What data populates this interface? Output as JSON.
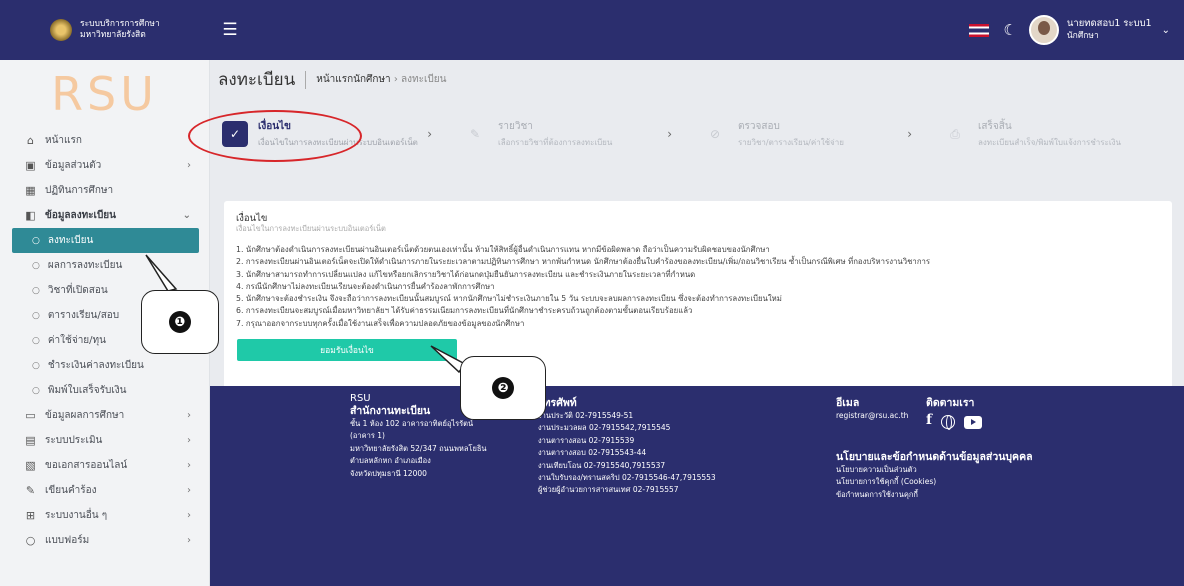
{
  "header": {
    "brand_line1": "ระบบบริการการศึกษา",
    "brand_line2": "มหาวิทยาลัยรังสิต",
    "user_name": "นายทดสอบ1 ระบบ1",
    "user_role": "นักศึกษา"
  },
  "sidebar": {
    "logo": "RSU",
    "items": [
      {
        "label": "หน้าแรก",
        "icon": "home-icon"
      },
      {
        "label": "ข้อมูลส่วนตัว",
        "icon": "id-card-icon"
      },
      {
        "label": "ปฏิทินการศึกษา",
        "icon": "calendar-icon"
      },
      {
        "label": "ข้อมูลลงทะเบียน",
        "icon": "register-icon"
      },
      {
        "label": "ลงทะเบียน"
      },
      {
        "label": "ผลการลงทะเบียน"
      },
      {
        "label": "วิชาที่เปิดสอน"
      },
      {
        "label": "ตารางเรียน/สอบ"
      },
      {
        "label": "ค่าใช้จ่าย/ทุน"
      },
      {
        "label": "ชำระเงินค่าลงทะเบียน"
      },
      {
        "label": "พิมพ์ใบเสร็จรับเงิน"
      },
      {
        "label": "ข้อมูลผลการศึกษา",
        "icon": "monitor-icon"
      },
      {
        "label": "ระบบประเมิน",
        "icon": "clipboard-icon"
      },
      {
        "label": "ขอเอกสารออนไลน์",
        "icon": "document-icon"
      },
      {
        "label": "เขียนคำร้อง",
        "icon": "edit-icon"
      },
      {
        "label": "ระบบงานอื่น ๆ",
        "icon": "grid-icon"
      },
      {
        "label": "แบบฟอร์ม",
        "icon": "circle-icon"
      }
    ]
  },
  "page": {
    "title": "ลงทะเบียน",
    "breadcrumb_home": "หน้าแรกนักศึกษา",
    "breadcrumb_sep": "›",
    "breadcrumb_current": "ลงทะเบียน"
  },
  "steps": [
    {
      "name": "เงื่อนไข",
      "desc": "เงื่อนไขในการลงทะเบียนผ่านระบบอินเตอร์เน็ต"
    },
    {
      "name": "รายวิชา",
      "desc": "เลือกรายวิชาที่ต้องการลงทะเบียน"
    },
    {
      "name": "ตรวจสอบ",
      "desc": "รายวิชา/ตารางเรียน/ค่าใช้จ่าย"
    },
    {
      "name": "เสร็จสิ้น",
      "desc": "ลงทะเบียนสำเร็จ/พิมพ์ใบแจ้งการชำระเงิน"
    }
  ],
  "card": {
    "heading": "เงื่อนไข",
    "subheading": "เงื่อนไขในการลงทะเบียนผ่านระบบอินเตอร์เน็ต",
    "rules": [
      "1. นักศึกษาต้องดำเนินการลงทะเบียนผ่านอินเตอร์เน็ตด้วยตนเองเท่านั้น ห้ามให้สิทธิ์ผู้อื่นดำเนินการแทน หากมีข้อผิดพลาด ถือว่าเป็นความรับผิดชอบของนักศึกษา",
      "2. การลงทะเบียนผ่านอินเตอร์เน็ตจะเปิดให้ดำเนินการภายในระยะเวลาตามปฏิทินการศึกษา หากพ้นกำหนด นักศึกษาต้องยื่นใบคำร้องขอลงทะเบียน/เพิ่ม/ถอนวิชาเรียน ซ้ำเป็นกรณีพิเศษ ที่กองบริหารงานวิชาการ",
      "3. นักศึกษาสามารถทำการเปลี่ยนแปลง แก้ไขหรือยกเลิกรายวิชาได้ก่อนกดปุ่มยืนยันการลงทะเบียน และชำระเงินภายในระยะเวลาที่กำหนด",
      "4. กรณีนักศึกษาไม่ลงทะเบียนเรียนจะต้องดำเนินการยื่นคำร้องลาพักการศึกษา",
      "5. นักศึกษาจะต้องชำระเงิน จึงจะถือว่าการลงทะเบียนนั้นสมบูรณ์ หากนักศึกษาไม่ชำระเงินภายใน 5 วัน ระบบจะลบผลการลงทะเบียน ซึ่งจะต้องทำการลงทะเบียนใหม่",
      "6. การลงทะเบียนจะสมบูรณ์เมื่อมหาวิทยาลัยฯ ได้รับค่าธรรมเนียมการลงทะเบียนที่นักศึกษาชำระครบถ้วนถูกต้องตามขั้นตอนเรียบร้อยแล้ว",
      "7. กรุณาออกจากระบบทุกครั้งเมื่อใช้งานเสร็จเพื่อความปลอดภัยของข้อมูลของนักศึกษา"
    ],
    "accept_label": "ยอมรับเงื่อนไข"
  },
  "footer": {
    "logo": "RSU",
    "office_title": "สำนักงานทะเบียน",
    "address": [
      "ชั้น 1 ห้อง 102 อาคารอาทิตย์อุไรรัตน์",
      "(อาคาร 1)",
      "มหาวิทยาลัยรังสิต 52/347 ถนนพหลโยธิน",
      "ตำบลหลักหก อำเภอเมือง",
      "จังหวัดปทุมธานี 12000"
    ],
    "phone_title": "โทรศัพท์",
    "phones": [
      "งานประวัติ 02-7915549-51",
      "งานประมวลผล 02-7915542,7915545",
      "งานตารางสอน 02-7915539",
      "งานตารางสอบ 02-7915543-44",
      "งานเทียบโอน 02-7915540,7915537",
      "งานใบรับรอง/ทรานสคริป 02-7915546-47,7915553",
      "ผู้ช่วยผู้อำนวยการสารสนเทศ 02-7915557"
    ],
    "email_title": "อีเมล",
    "email": "registrar@rsu.ac.th",
    "follow_title": "ติดตามเรา",
    "policy_title": "นโยบายและข้อกำหนดด้านข้อมูลส่วนบุคคล",
    "policies": [
      "นโยบายความเป็นส่วนตัว",
      "นโยบายการใช้คุกกี้ (Cookies)",
      "ข้อกำหนดการใช้งานคุกกี้"
    ]
  },
  "annotations": {
    "callout1": "❶",
    "callout2": "❷"
  }
}
